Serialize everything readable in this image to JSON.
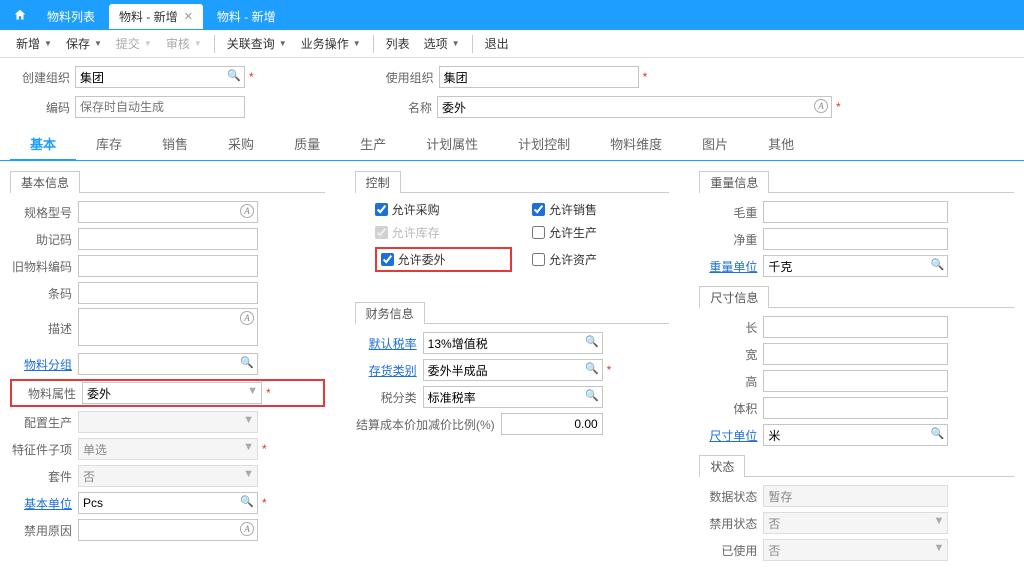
{
  "tabs": {
    "list": "物料列表",
    "add_active": "物料 - 新增",
    "add_other": "物料 - 新增"
  },
  "toolbar": {
    "new": "新增",
    "save": "保存",
    "submit": "提交",
    "audit": "审核",
    "relquery": "关联查询",
    "bizop": "业务操作",
    "list": "列表",
    "options": "选项",
    "exit": "退出"
  },
  "header": {
    "create_org_label": "创建组织",
    "create_org_value": "集团",
    "use_org_label": "使用组织",
    "use_org_value": "集团",
    "code_label": "编码",
    "code_placeholder": "保存时自动生成",
    "name_label": "名称",
    "name_value": "委外"
  },
  "subtabs": [
    "基本",
    "库存",
    "销售",
    "采购",
    "质量",
    "生产",
    "计划属性",
    "计划控制",
    "物料维度",
    "图片",
    "其他"
  ],
  "col1": {
    "section": "基本信息",
    "spec_label": "规格型号",
    "mnemonic_label": "助记码",
    "old_code_label": "旧物料编码",
    "barcode_label": "条码",
    "desc_label": "描述",
    "group_label": "物料分组",
    "attr_label": "物料属性",
    "attr_value": "委外",
    "mfgconf_label": "配置生产",
    "featsub_label": "特征件子项",
    "featsub_value": "单选",
    "kit_label": "套件",
    "kit_value": "否",
    "base_unit_label": "基本单位",
    "base_unit_value": "Pcs",
    "disable_reason_label": "禁用原因"
  },
  "col2": {
    "section_ctrl": "控制",
    "cb_purchase": "允许采购",
    "cb_stock": "允许库存",
    "cb_outsrc": "允许委外",
    "cb_sale": "允许销售",
    "cb_prod": "允许生产",
    "cb_asset": "允许资产",
    "section_fin": "财务信息",
    "tax_rate_label": "默认税率",
    "tax_rate_value": "13%增值税",
    "stock_cat_label": "存货类别",
    "stock_cat_value": "委外半成品",
    "tax_class_label": "税分类",
    "tax_class_value": "标准税率",
    "cost_ratio_label": "结算成本价加减价比例(%)",
    "cost_ratio_value": "0.00"
  },
  "col3": {
    "section_weight": "重量信息",
    "gross_label": "毛重",
    "net_label": "净重",
    "weight_unit_label": "重量单位",
    "weight_unit_value": "千克",
    "section_size": "尺寸信息",
    "length_label": "长",
    "width_label": "宽",
    "height_label": "高",
    "volume_label": "体积",
    "size_unit_label": "尺寸单位",
    "size_unit_value": "米",
    "section_status": "状态",
    "data_status_label": "数据状态",
    "data_status_value": "暂存",
    "forbid_status_label": "禁用状态",
    "forbid_status_value": "否",
    "used_label": "已使用",
    "used_value": "否"
  }
}
